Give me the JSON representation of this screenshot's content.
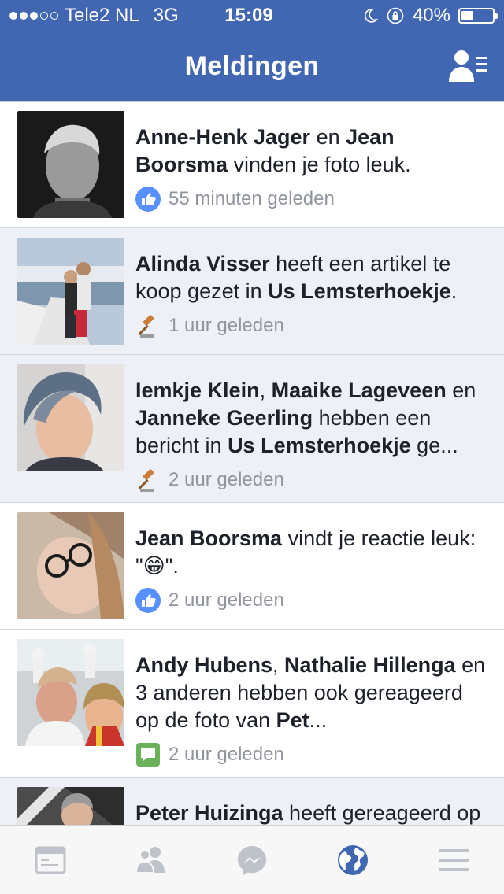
{
  "status_bar": {
    "carrier": "Tele2 NL",
    "network": "3G",
    "time": "15:09",
    "battery": "40%",
    "battery_level": 0.4,
    "signal_bars_filled": 3,
    "signal_bars_total": 5
  },
  "header": {
    "title": "Meldingen",
    "right_icon": "friend-requests-icon"
  },
  "notifications": [
    {
      "parts": [
        {
          "text": "Anne-Henk Jager",
          "bold": true
        },
        {
          "text": " en ",
          "bold": false
        },
        {
          "text": "Jean Boorsma",
          "bold": true
        },
        {
          "text": " vinden je foto leuk.",
          "bold": false
        }
      ],
      "icon": "like-icon",
      "time": "55 minuten geleden",
      "unread": false
    },
    {
      "parts": [
        {
          "text": "Alinda Visser",
          "bold": true
        },
        {
          "text": " heeft een artikel te koop gezet in ",
          "bold": false
        },
        {
          "text": "Us Lemsterhoekje",
          "bold": true
        },
        {
          "text": ".",
          "bold": false
        }
      ],
      "icon": "gavel-icon",
      "time": "1 uur geleden",
      "unread": true
    },
    {
      "parts": [
        {
          "text": "Iemkje Klein",
          "bold": true
        },
        {
          "text": ", ",
          "bold": false
        },
        {
          "text": "Maaike Lageveen",
          "bold": true
        },
        {
          "text": " en ",
          "bold": false
        },
        {
          "text": "Janneke Geerling",
          "bold": true
        },
        {
          "text": " hebben een bericht in ",
          "bold": false
        },
        {
          "text": "Us Lemsterhoekje",
          "bold": true
        },
        {
          "text": " ge...",
          "bold": false
        }
      ],
      "icon": "gavel-icon",
      "time": "2 uur geleden",
      "unread": true
    },
    {
      "parts": [
        {
          "text": "Jean Boorsma",
          "bold": true
        },
        {
          "text": " vindt je reactie leuk: \"",
          "bold": false
        },
        {
          "text": "😁",
          "bold": false
        },
        {
          "text": "\".",
          "bold": false
        }
      ],
      "icon": "like-icon",
      "time": "2 uur geleden",
      "unread": false
    },
    {
      "parts": [
        {
          "text": "Andy Hubens",
          "bold": true
        },
        {
          "text": ", ",
          "bold": false
        },
        {
          "text": "Nathalie Hillenga",
          "bold": true
        },
        {
          "text": " en 3 anderen hebben ook gereageerd op de foto van ",
          "bold": false
        },
        {
          "text": "Pet",
          "bold": true
        },
        {
          "text": "...",
          "bold": false
        }
      ],
      "icon": "comment-icon",
      "time": "2 uur geleden",
      "unread": false
    },
    {
      "parts": [
        {
          "text": "Peter Huizinga",
          "bold": true
        },
        {
          "text": " heeft gereageerd op je reactie op zijn foto.",
          "bold": false
        }
      ],
      "icon": "comment-icon",
      "time": "",
      "unread": true
    }
  ],
  "tab_bar": {
    "tabs": [
      {
        "name": "news-feed-icon",
        "active": false
      },
      {
        "name": "friends-icon",
        "active": false
      },
      {
        "name": "messenger-icon",
        "active": false
      },
      {
        "name": "globe-icon",
        "active": true
      },
      {
        "name": "menu-icon",
        "active": false
      }
    ]
  },
  "colors": {
    "brand": "#4267b2",
    "unread_bg": "#edf0f7",
    "like_blue": "#5890ff",
    "comment_green": "#6bb25a",
    "tab_inactive": "#bec2c9"
  }
}
